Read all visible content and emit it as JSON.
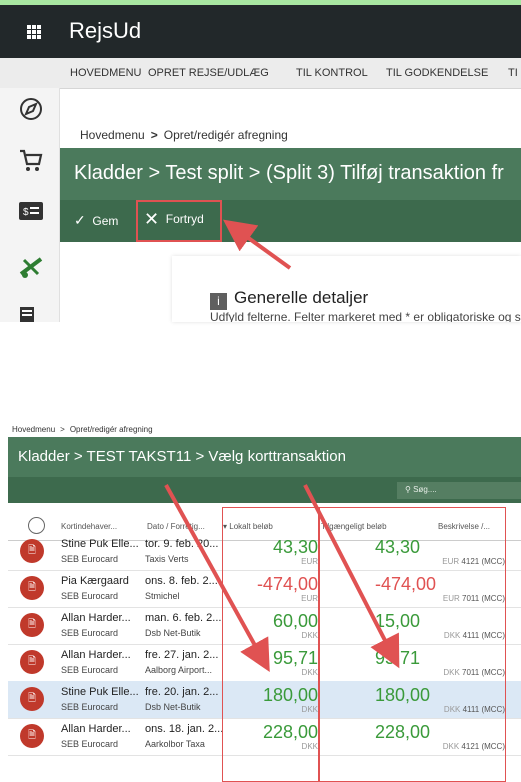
{
  "app": {
    "title": "RejsUd"
  },
  "menu": [
    "HOVEDMENU",
    "OPRET REJSE/UDLÆG",
    "TIL KONTROL",
    "TIL GODKENDELSE",
    "TI"
  ],
  "top": {
    "breadcrumb": [
      "Hovedmenu",
      "Opret/redigér afregning"
    ],
    "title": "Kladder  >  Test split  >  (Split 3) Tilføj transaktion fr",
    "toolbar": {
      "save": "Gem",
      "undo": "Fortryd"
    },
    "section_title": "Generelle detaljer",
    "section_text": "Udfyld felterne. Felter markeret med * er obligatoriske og skal udfyldes for at fortsætte"
  },
  "bottom": {
    "breadcrumb": [
      "Hovedmenu",
      "Opret/redigér afregning"
    ],
    "title": "Kladder  >  TEST TAKST11  >  Vælg korttransaktion",
    "search_placeholder": "Søg....",
    "columns": {
      "holder": "Kortindehaver...",
      "date": "Dato / Forretig...",
      "local": "Lokalt beløb",
      "account": "Tilgængeligt beløb",
      "desc": "Beskrivelse /..."
    },
    "rows": [
      {
        "holder": "Stine Puk Elle...",
        "card": "SEB Eurocard",
        "date": "tor. 9. feb. 20...",
        "merchant": "Taxis Verts",
        "local": "43,30",
        "local_cur": "EUR",
        "acct": "43,30",
        "acct_cur": "EUR",
        "desc": "4121 (MCC)",
        "neg": false,
        "selected": false
      },
      {
        "holder": "Pia Kærgaard",
        "card": "SEB Eurocard",
        "date": "ons. 8. feb. 2...",
        "merchant": "Stmichel",
        "local": "-474,00",
        "local_cur": "EUR",
        "acct": "-474,00",
        "acct_cur": "EUR",
        "desc": "7011 (MCC)",
        "neg": true,
        "selected": false
      },
      {
        "holder": "Allan Harder...",
        "card": "SEB Eurocard",
        "date": "man. 6. feb. 2...",
        "merchant": "Dsb Net-Butik",
        "local": "60,00",
        "local_cur": "DKK",
        "acct": "15,00",
        "acct_cur": "DKK",
        "desc": "4111 (MCC)",
        "neg": false,
        "selected": false
      },
      {
        "holder": "Allan Harder...",
        "card": "SEB Eurocard",
        "date": "fre. 27. jan. 2...",
        "merchant": "Aalborg Airport...",
        "local": "95,71",
        "local_cur": "DKK",
        "acct": "95,71",
        "acct_cur": "DKK",
        "desc": "7011 (MCC)",
        "neg": false,
        "selected": false
      },
      {
        "holder": "Stine Puk Elle...",
        "card": "SEB Eurocard",
        "date": "fre. 20. jan. 2...",
        "merchant": "Dsb Net-Butik",
        "local": "180,00",
        "local_cur": "DKK",
        "acct": "180,00",
        "acct_cur": "DKK",
        "desc": "4111 (MCC)",
        "neg": false,
        "selected": true
      },
      {
        "holder": "Allan Harder...",
        "card": "SEB Eurocard",
        "date": "ons. 18. jan. 2...",
        "merchant": "Aarkolbor Taxa",
        "local": "228,00",
        "local_cur": "DKK",
        "acct": "228,00",
        "acct_cur": "DKK",
        "desc": "4121 (MCC)",
        "neg": false,
        "selected": false
      }
    ]
  },
  "colors": {
    "green_dark": "#3d6a4d",
    "green": "#4b7a5c",
    "annotation_red": "#e05252",
    "amount_green": "#3a9a3a"
  }
}
